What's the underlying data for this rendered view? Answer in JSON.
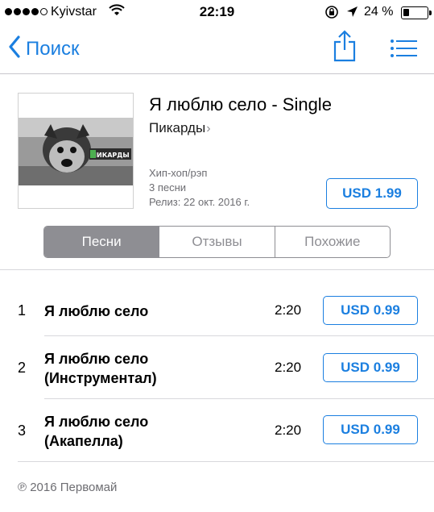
{
  "status_bar": {
    "carrier": "Kyivstar",
    "time": "22:19",
    "battery": "24 %",
    "battery_level": 0.24,
    "signal_bars": 4
  },
  "nav": {
    "back_label": "Поиск",
    "back_icon": "chevron-left-icon",
    "share_icon": "share-icon",
    "list_icon": "list-icon"
  },
  "album": {
    "title": "Я люблю село - Single",
    "artist": "Пикарды",
    "genre": "Хип-хоп/рэп",
    "track_count": "3 песни",
    "release": "Релиз: 22 окт. 2016 г.",
    "price": "USD 1.99",
    "artwork_text": "ПИКАРДЫ"
  },
  "tabs": [
    {
      "label": "Песни",
      "active": true
    },
    {
      "label": "Отзывы",
      "active": false
    },
    {
      "label": "Похожие",
      "active": false
    }
  ],
  "tracks": [
    {
      "num": "1",
      "line1": "Я люблю село",
      "line2": "",
      "duration": "2:20",
      "price": "USD 0.99"
    },
    {
      "num": "2",
      "line1": "Я люблю село",
      "line2": "(Инструментал)",
      "duration": "2:20",
      "price": "USD 0.99"
    },
    {
      "num": "3",
      "line1": "Я люблю село",
      "line2": "(Акапелла)",
      "duration": "2:20",
      "price": "USD 0.99"
    }
  ],
  "copyright": "℗ 2016 Первомай",
  "colors": {
    "accent": "#1b7fe0",
    "segment_active": "#8e8e93",
    "secondary_text": "#6d6d72"
  }
}
